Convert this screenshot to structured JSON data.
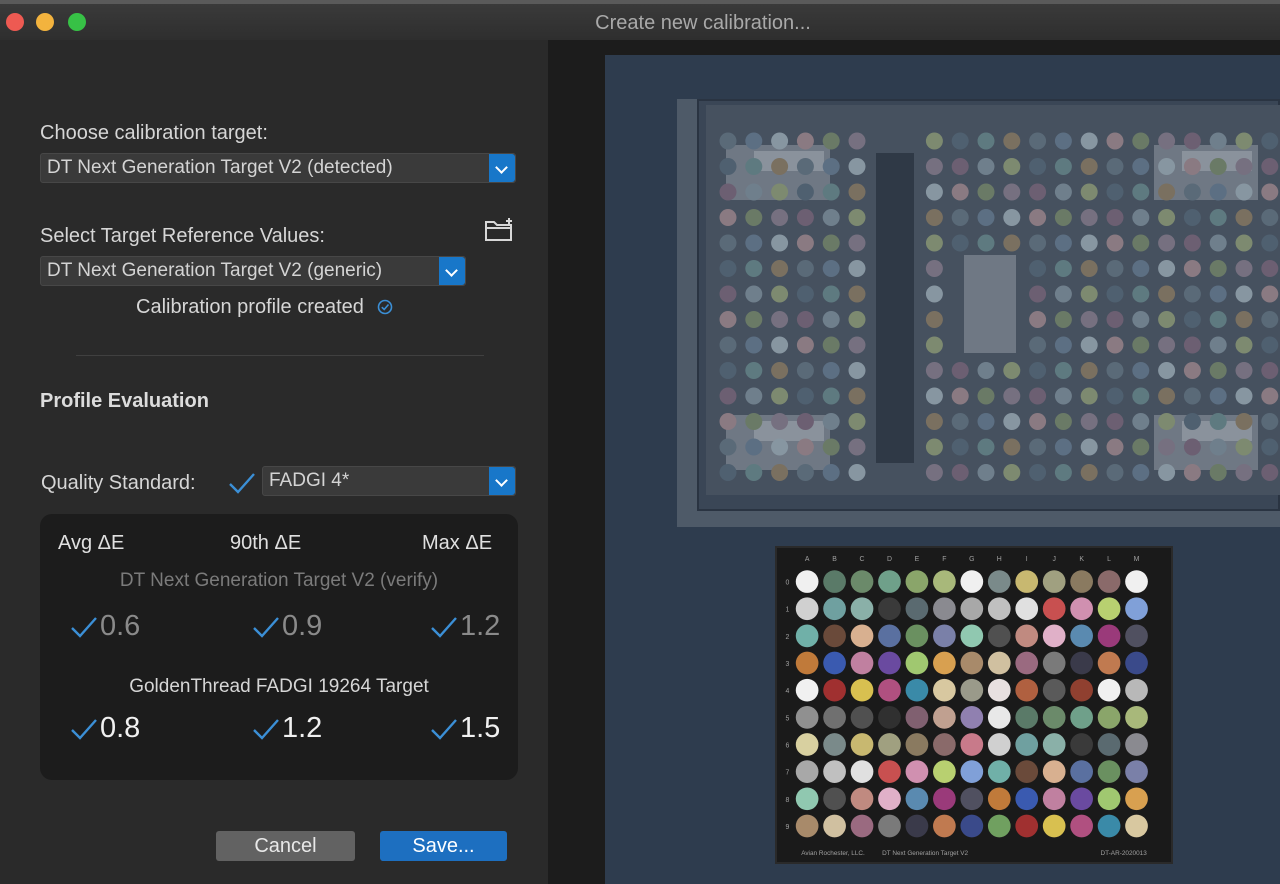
{
  "window": {
    "title": "Create new calibration..."
  },
  "form": {
    "target_label": "Choose calibration target:",
    "target_value": "DT Next Generation Target V2 (detected)",
    "reference_label": "Select Target Reference Values:",
    "reference_value": "DT Next Generation Target V2 (generic)",
    "status_text": "Calibration profile created"
  },
  "evaluation": {
    "section_title": "Profile Evaluation",
    "quality_label": "Quality Standard:",
    "quality_value": "FADGI 4*",
    "columns": [
      "Avg ΔE",
      "90th ΔE",
      "Max ΔE"
    ],
    "targets": [
      {
        "name": "DT Next Generation Target V2 (verify)",
        "values": [
          "0.6",
          "0.9",
          "1.2"
        ]
      },
      {
        "name": "GoldenThread FADGI 19264 Target",
        "values": [
          "0.8",
          "1.2",
          "1.5"
        ]
      }
    ]
  },
  "buttons": {
    "cancel": "Cancel",
    "save": "Save..."
  },
  "preview": {
    "fadgi_cols": [
      "A",
      "B",
      "C",
      "D",
      "E",
      "F",
      "G",
      "H",
      "I",
      "J",
      "K",
      "L",
      "M"
    ],
    "fadgi_rows": [
      "0",
      "1",
      "2",
      "3",
      "4",
      "5",
      "6",
      "7",
      "8",
      "9"
    ],
    "fadgi_footer_left": "Avian Rochester, LLC.",
    "fadgi_footer_mid": "DT Next Generation Target V2",
    "fadgi_footer_right": "DT-AR-2020013"
  },
  "colors": {
    "accent": "#1877c9",
    "check": "#3b8fd6"
  }
}
